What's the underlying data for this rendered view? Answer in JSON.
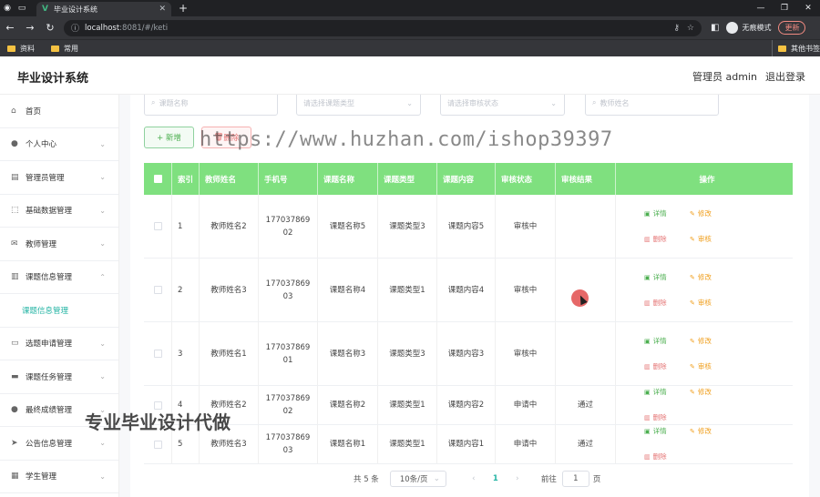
{
  "browser": {
    "tab_title": "毕业设计系统",
    "url_host": "localhost",
    "url_path": ":8081/#/keti",
    "incognito_label": "无痕模式",
    "update_label": "更新",
    "bookmarks": [
      "资料",
      "常用"
    ],
    "bookmarks_other": "其他书签"
  },
  "header": {
    "app_title": "毕业设计系统",
    "admin_label": "管理员 admin",
    "logout_label": "退出登录"
  },
  "sidebar": {
    "items": [
      {
        "label": "首页",
        "icon": "home-icon",
        "glyph": "⌂",
        "chevron": false
      },
      {
        "label": "个人中心",
        "icon": "user-icon",
        "glyph": "●",
        "chevron": true
      },
      {
        "label": "管理员管理",
        "icon": "clipboard-icon",
        "glyph": "▤",
        "chevron": true
      },
      {
        "label": "基础数据管理",
        "icon": "frame-icon",
        "glyph": "⬚",
        "chevron": true
      },
      {
        "label": "教师管理",
        "icon": "mail-icon",
        "glyph": "✉",
        "chevron": true
      },
      {
        "label": "课题信息管理",
        "icon": "document-icon",
        "glyph": "▥",
        "chevron": true,
        "expanded": true
      },
      {
        "label": "课题信息管理",
        "sub": true
      },
      {
        "label": "选题申请管理",
        "icon": "message-icon",
        "glyph": "▭",
        "chevron": true
      },
      {
        "label": "课题任务管理",
        "icon": "monitor-icon",
        "glyph": "▬",
        "chevron": true
      },
      {
        "label": "最终成绩管理",
        "icon": "pin-icon",
        "glyph": "●",
        "chevron": true
      },
      {
        "label": "公告信息管理",
        "icon": "send-icon",
        "glyph": "➤",
        "chevron": true
      },
      {
        "label": "学生管理",
        "icon": "grid-icon",
        "glyph": "▦",
        "chevron": true
      }
    ]
  },
  "search": {
    "title_placeholder": "课题名称",
    "type_placeholder": "请选择课题类型",
    "status_placeholder": "请选择审核状态",
    "teacher_placeholder": "教师姓名"
  },
  "actions": {
    "add_label": "+ 新增",
    "delete_label": "删除"
  },
  "watermark": {
    "url_text": "https://www.huzhan.com/ishop39397",
    "ad_text": "专业毕业设计代做"
  },
  "table": {
    "columns": [
      "",
      "索引",
      "教师姓名",
      "手机号",
      "课题名称",
      "课题类型",
      "课题内容",
      "审核状态",
      "审核结果",
      "操作"
    ],
    "op_labels": {
      "detail": "详情",
      "edit": "修改",
      "delete": "删除",
      "audit": "审核"
    },
    "rows": [
      {
        "index": "1",
        "teacher": "教师姓名2",
        "phone1": "177037869",
        "phone2": "02",
        "title": "课题名称5",
        "type": "课题类型3",
        "content": "课题内容5",
        "status": "审核中",
        "result": "",
        "audit": true
      },
      {
        "index": "2",
        "teacher": "教师姓名3",
        "phone1": "177037869",
        "phone2": "03",
        "title": "课题名称4",
        "type": "课题类型1",
        "content": "课题内容4",
        "status": "审核中",
        "result": "",
        "audit": true
      },
      {
        "index": "3",
        "teacher": "教师姓名1",
        "phone1": "177037869",
        "phone2": "01",
        "title": "课题名称3",
        "type": "课题类型3",
        "content": "课题内容3",
        "status": "审核中",
        "result": "",
        "audit": true
      },
      {
        "index": "4",
        "teacher": "教师姓名2",
        "phone1": "177037869",
        "phone2": "02",
        "title": "课题名称2",
        "type": "课题类型1",
        "content": "课题内容2",
        "status": "申请中",
        "result": "通过",
        "audit": false
      },
      {
        "index": "5",
        "teacher": "教师姓名3",
        "phone1": "177037869",
        "phone2": "03",
        "title": "课题名称1",
        "type": "课题类型1",
        "content": "课题内容1",
        "status": "申请中",
        "result": "通过",
        "audit": false
      }
    ]
  },
  "pagination": {
    "total_label": "共 5 条",
    "page_size": "10条/页",
    "current_page": "1",
    "goto_label": "前往",
    "goto_value": "1",
    "page_suffix": "页"
  },
  "colors": {
    "table_header": "#7fe07f",
    "accent": "#24b4a4",
    "detail": "#4caf50",
    "edit": "#f0a020",
    "delete": "#e57373"
  }
}
